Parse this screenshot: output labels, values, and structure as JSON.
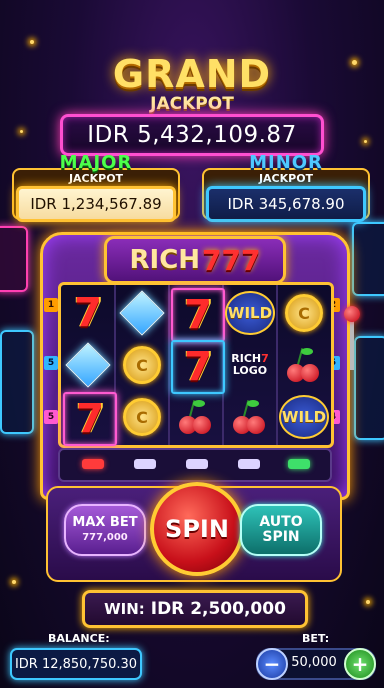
{
  "grand": {
    "title": "GRAND",
    "subtitle": "JACKPOT",
    "value": "IDR 5,432,109.87"
  },
  "major": {
    "title": "MAJOR",
    "subtitle": "JACKPOT",
    "value": "IDR 1,234,567.89"
  },
  "minor": {
    "title": "MINOR",
    "subtitle": "JACKPOT",
    "value": "IDR 345,678.90"
  },
  "machine": {
    "name_word": "RICH",
    "name_num": "777"
  },
  "reels": {
    "symbols": [
      [
        "seven",
        "diamond",
        "seven",
        "wild",
        "coin"
      ],
      [
        "diamond",
        "coin",
        "seven",
        "logo",
        "cherry"
      ],
      [
        "seven",
        "coin",
        "cherry",
        "cherry",
        "wild"
      ]
    ],
    "wild_text": "WILD",
    "seven_text": "7",
    "coin_text": "C",
    "logo_line1": "RICH",
    "logo_line1_num": "7",
    "logo_line2": "LOGO"
  },
  "paylines": {
    "left": [
      "1",
      "5",
      "5"
    ],
    "right": [
      "2",
      "5",
      "4"
    ]
  },
  "controls": {
    "max_bet_label": "MAX BET",
    "max_bet_value": "777,000",
    "spin_label": "SPIN",
    "auto_line1": "AUTO",
    "auto_line2": "SPIN"
  },
  "win": {
    "label": "WIN:",
    "value": "IDR 2,500,000"
  },
  "balance": {
    "label": "BALANCE:",
    "value": "IDR 12,850,750.30"
  },
  "bet": {
    "label": "BET:",
    "value": "50,000",
    "minus": "−",
    "plus": "+"
  },
  "colors": {
    "gold": "#ffc233",
    "neon_pink": "#ff3fb4",
    "neon_blue": "#3ec8ff",
    "spin_red": "#c8101a"
  }
}
